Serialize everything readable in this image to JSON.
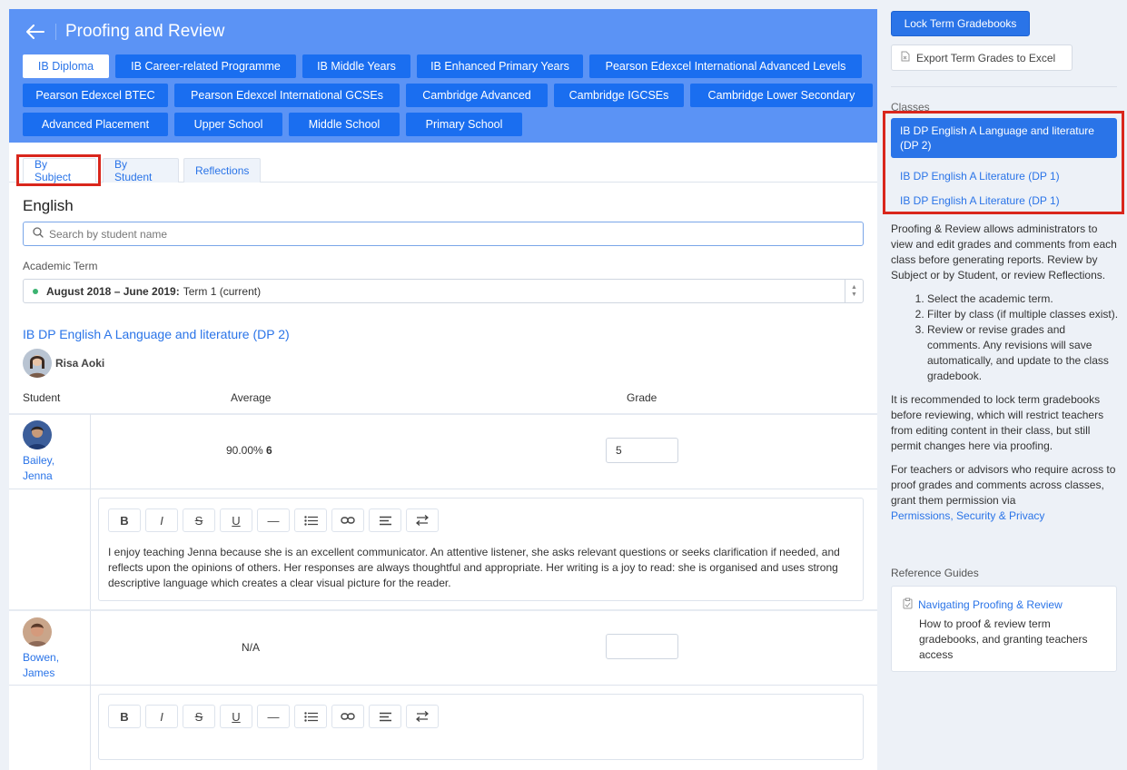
{
  "header": {
    "title": "Proofing and Review",
    "programmes": [
      [
        "IB Diploma",
        "IB Career-related Programme",
        "IB Middle Years",
        "IB Enhanced Primary Years",
        "Pearson Edexcel International Advanced Levels"
      ],
      [
        "Pearson Edexcel BTEC",
        "Pearson Edexcel International GCSEs",
        "Cambridge Advanced",
        "Cambridge IGCSEs",
        "Cambridge Lower Secondary"
      ],
      [
        "Advanced Placement",
        "Upper School",
        "Middle School",
        "Primary School"
      ]
    ]
  },
  "tabs": [
    "By Subject",
    "By Student",
    "Reflections"
  ],
  "subject": "English",
  "search": {
    "placeholder": "Search by student name"
  },
  "term": {
    "label": "Academic Term",
    "range": "August 2018 – June 2019:",
    "value": "Term 1 (current)",
    "status_color": "#3cb371"
  },
  "class_title": "IB DP English A Language and literature (DP 2)",
  "teacher": "Risa Aoki",
  "columns": {
    "student": "Student",
    "average": "Average",
    "grade": "Grade"
  },
  "students": [
    {
      "name_line1": "Bailey,",
      "name_line2": "Jenna",
      "average": "90.00%",
      "average_grade": "6",
      "grade": "5",
      "comment": "I enjoy teaching Jenna because she is an excellent communicator. An attentive listener, she asks relevant questions or seeks clarification if needed, and reflects upon the opinions of others. Her responses are always thoughtful and appropriate. Her writing is a joy to read: she is organised and uses strong descriptive language which creates a clear visual picture for the reader."
    },
    {
      "name_line1": "Bowen,",
      "name_line2": "James",
      "average": "N/A",
      "average_grade": "",
      "grade": "",
      "comment": ""
    }
  ],
  "toolbar": [
    "B",
    "I",
    "S",
    "U",
    "—",
    "list",
    "link",
    "align",
    "swap"
  ],
  "sidebar": {
    "lock_button": "Lock Term Gradebooks",
    "export_button": "Export Term Grades to Excel",
    "classes_label": "Classes",
    "classes": [
      "IB DP English A Language and literature (DP 2)",
      "IB DP English A Literature (DP 1)",
      "IB DP English A Literature (DP 1)"
    ],
    "help_intro": "Proofing & Review allows administrators to view and edit grades and comments from each class before generating reports. Review by Subject or by Student, or review Reflections.",
    "steps": [
      "Select the academic term.",
      "Filter by class (if multiple classes exist).",
      "Review or revise grades and comments. Any revisions will save automatically, and update to the class gradebook."
    ],
    "help_lock": "It is recommended to lock term gradebooks before reviewing, which will restrict teachers from editing content in their class, but still permit changes here via proofing.",
    "help_perm": "For teachers or advisors who require across to proof grades and comments across classes, grant them permission via",
    "help_perm_link": "Permissions, Security & Privacy",
    "ref_label": "Reference Guides",
    "ref_title": "Navigating Proofing & Review",
    "ref_desc": "How to proof & review term gradebooks, and granting teachers access"
  },
  "colors": {
    "header_bg": "#5b93f5",
    "accent": "#2a74e8",
    "highlight": "#d9261c"
  }
}
